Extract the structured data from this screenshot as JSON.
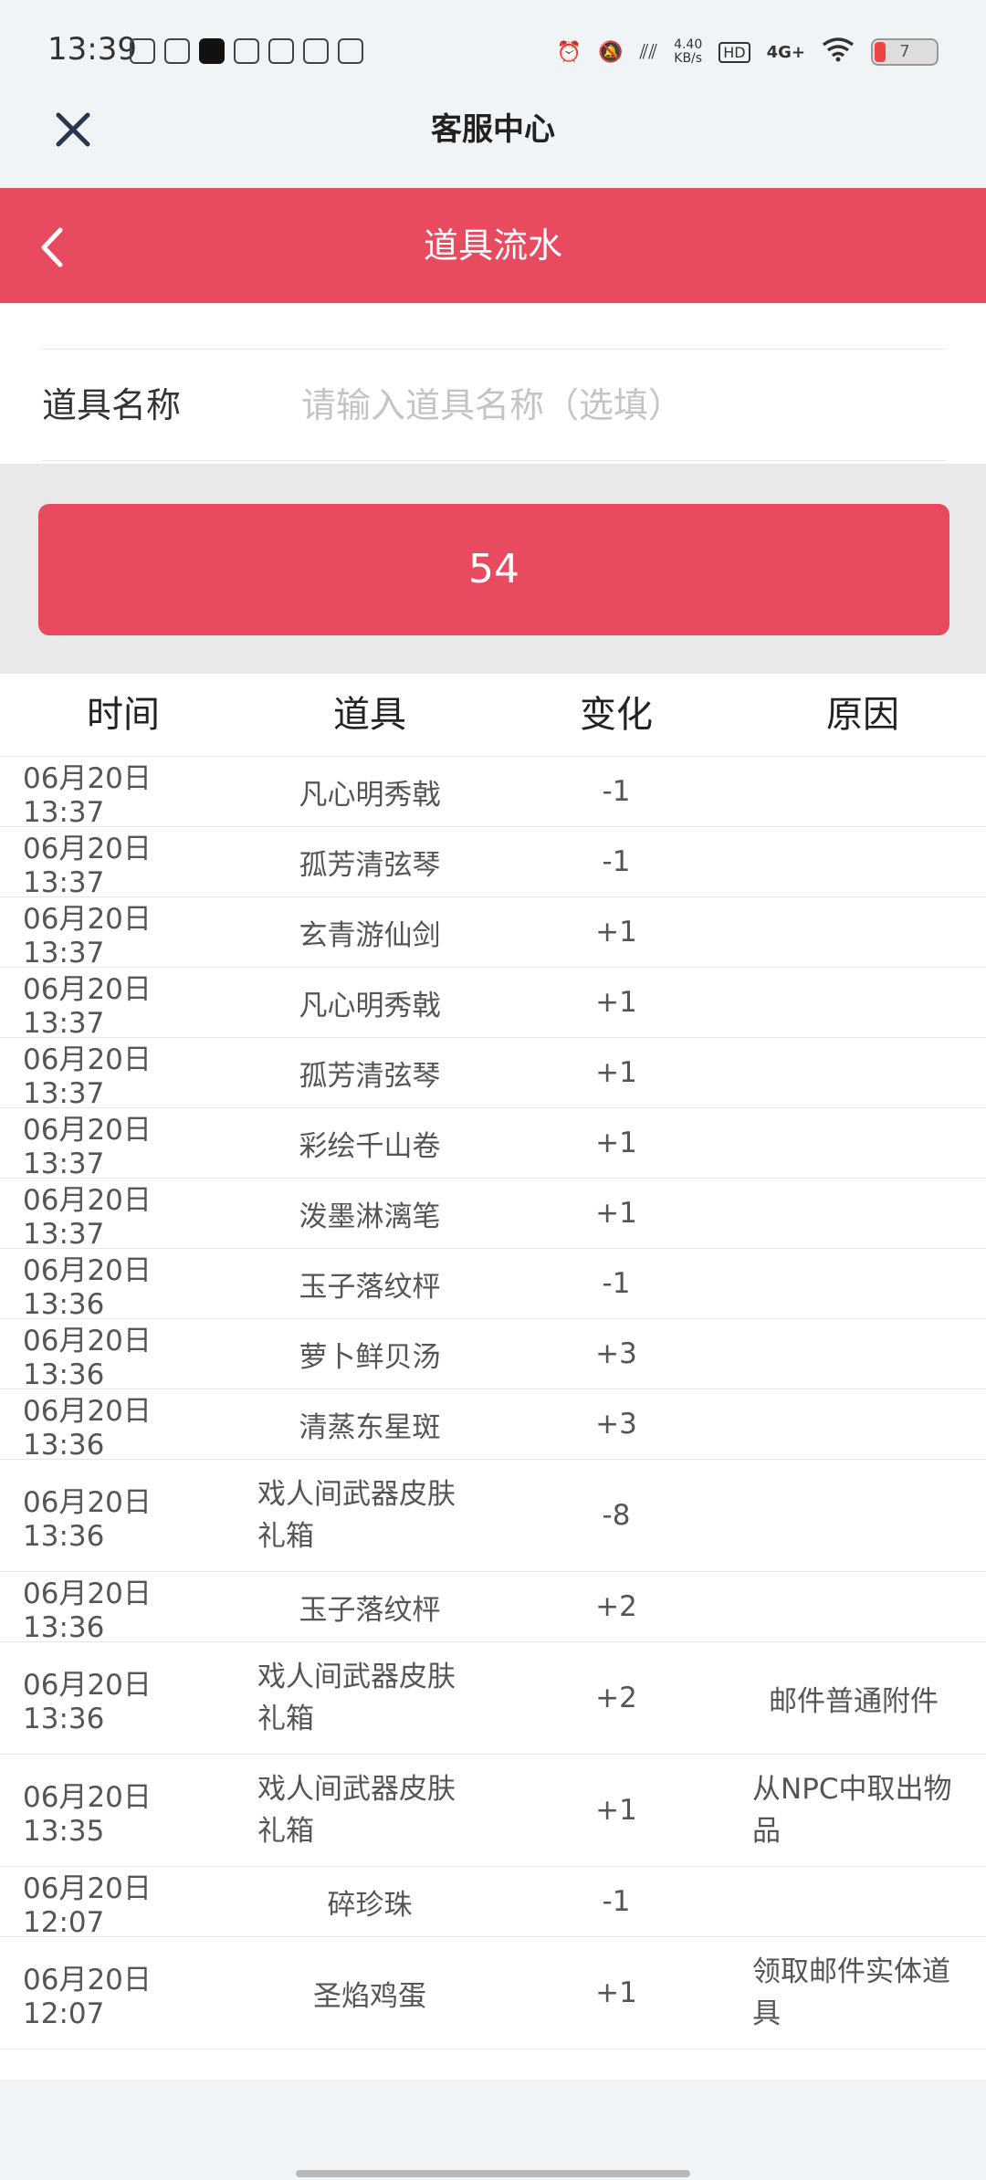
{
  "status_bar": {
    "time": "13:39",
    "net_speed_value": "4.40",
    "net_speed_unit": "KB/s",
    "hd_label": "HD",
    "network_label": "4G+",
    "battery_level": "7"
  },
  "app_header": {
    "title": "客服中心",
    "close_icon": "close-icon"
  },
  "nav_bar": {
    "title": "道具流水",
    "back_icon": "chevron-left-icon",
    "color": "#e84a5f"
  },
  "form": {
    "item_name_label": "道具名称",
    "item_name_placeholder": "请输入道具名称（选填）",
    "item_name_value": ""
  },
  "count_button": {
    "label": "54"
  },
  "table": {
    "headers": [
      "时间",
      "道具",
      "变化",
      "原因"
    ],
    "rows": [
      {
        "time": "06月20日 13:37",
        "item": "凡心明秀戟",
        "change": "-1",
        "reason": ""
      },
      {
        "time": "06月20日 13:37",
        "item": "孤芳清弦琴",
        "change": "-1",
        "reason": ""
      },
      {
        "time": "06月20日 13:37",
        "item": "玄青游仙剑",
        "change": "+1",
        "reason": ""
      },
      {
        "time": "06月20日 13:37",
        "item": "凡心明秀戟",
        "change": "+1",
        "reason": ""
      },
      {
        "time": "06月20日 13:37",
        "item": "孤芳清弦琴",
        "change": "+1",
        "reason": ""
      },
      {
        "time": "06月20日 13:37",
        "item": "彩绘千山卷",
        "change": "+1",
        "reason": ""
      },
      {
        "time": "06月20日 13:37",
        "item": "泼墨淋漓笔",
        "change": "+1",
        "reason": ""
      },
      {
        "time": "06月20日 13:36",
        "item": "玉子落纹枰",
        "change": "-1",
        "reason": ""
      },
      {
        "time": "06月20日 13:36",
        "item": "萝卜鲜贝汤",
        "change": "+3",
        "reason": ""
      },
      {
        "time": "06月20日 13:36",
        "item": "清蒸东星斑",
        "change": "+3",
        "reason": ""
      },
      {
        "time": "06月20日 13:36",
        "item": "戏人间武器皮肤礼箱",
        "change": "-8",
        "reason": ""
      },
      {
        "time": "06月20日 13:36",
        "item": "玉子落纹枰",
        "change": "+2",
        "reason": ""
      },
      {
        "time": "06月20日 13:36",
        "item": "戏人间武器皮肤礼箱",
        "change": "+2",
        "reason": "邮件普通附件"
      },
      {
        "time": "06月20日 13:35",
        "item": "戏人间武器皮肤礼箱",
        "change": "+1",
        "reason": "从NPC中取出物品"
      },
      {
        "time": "06月20日 12:07",
        "item": "碎珍珠",
        "change": "-1",
        "reason": ""
      },
      {
        "time": "06月20日 12:07",
        "item": "圣焰鸡蛋",
        "change": "+1",
        "reason": "领取邮件实体道具"
      }
    ]
  }
}
